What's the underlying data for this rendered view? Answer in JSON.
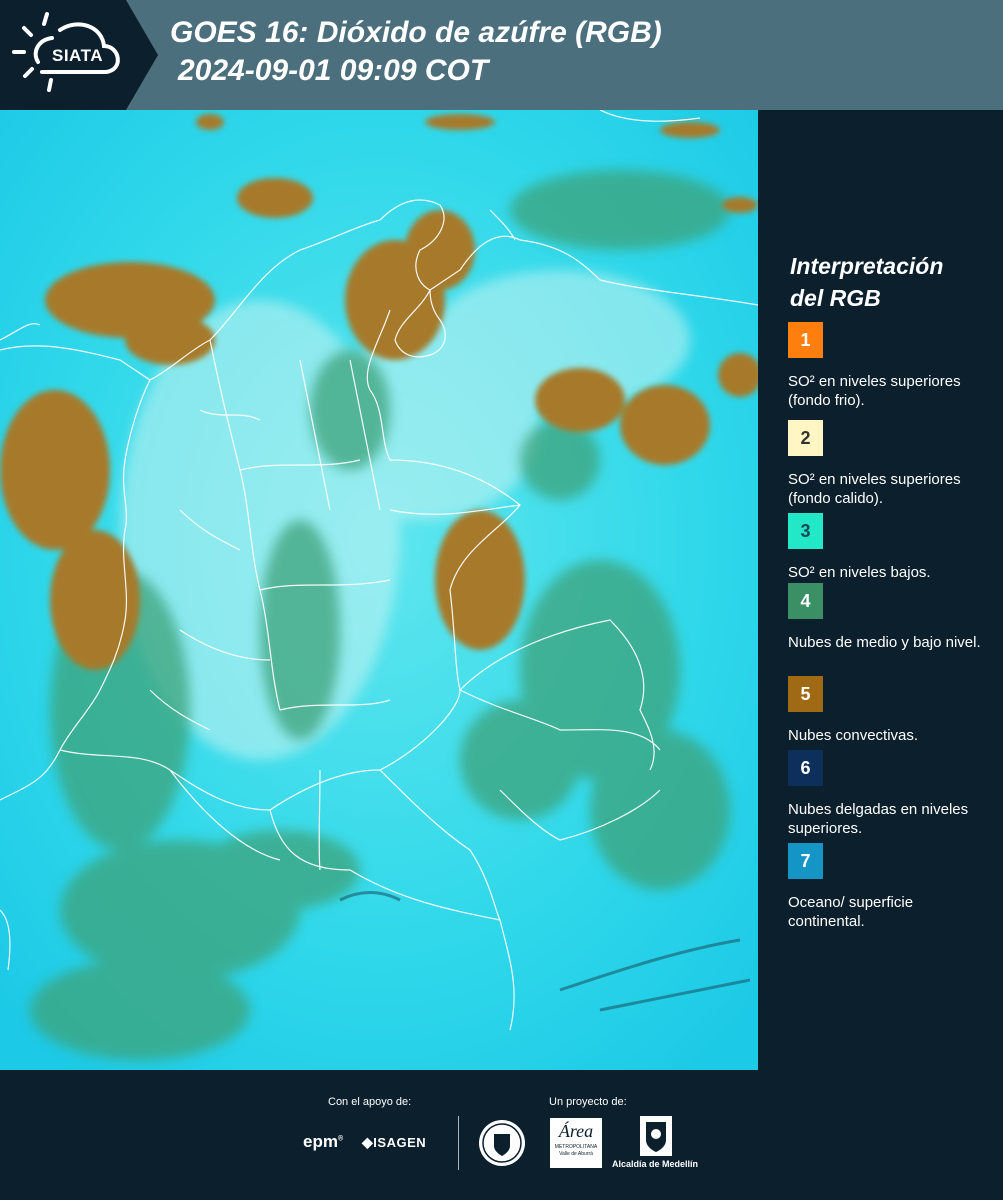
{
  "header": {
    "logo_text": "SIATA",
    "title_line1": "GOES 16: Dióxido de azúfre (RGB)",
    "title_line2": "2024-09-01 09:09 COT"
  },
  "map": {
    "background_color": "#1fd3e6",
    "cloud_color": "#a67a2b",
    "low_cloud_color": "#3ea37a",
    "border_color": "#ffffff"
  },
  "legend": {
    "title_line1": "Interpretación",
    "title_line2": "del RGB",
    "items": [
      {
        "number": "1",
        "color": "#ff7f0e",
        "text_color": "#ffffff",
        "label": "SO² en niveles superiores (fondo frio)."
      },
      {
        "number": "2",
        "color": "#fff6c3",
        "text_color": "#333333",
        "label": "SO² en niveles superiores (fondo calido)."
      },
      {
        "number": "3",
        "color": "#22e8c8",
        "text_color": "#1a4a55",
        "label": "SO² en niveles bajos."
      },
      {
        "number": "4",
        "color": "#3a8f65",
        "text_color": "#ffffff",
        "label": "Nubes de medio y bajo nivel."
      },
      {
        "number": "5",
        "color": "#a06a14",
        "text_color": "#ffffff",
        "label": "Nubes convectivas."
      },
      {
        "number": "6",
        "color": "#0c2f5c",
        "text_color": "#ffffff",
        "label": "Nubes delgadas en niveles superiores."
      },
      {
        "number": "7",
        "color": "#1495c6",
        "text_color": "#ffffff",
        "label": "Oceano/ superficie continental."
      }
    ]
  },
  "footer": {
    "support_label": "Con el apoyo de:",
    "project_label": "Un proyecto de:",
    "partner1": "epm",
    "partner2": "ISAGEN",
    "area_word": "Área",
    "area_sub1": "METROPOLITANA",
    "area_sub2": "Valle de Aburrá",
    "alcaldia": "Alcaldía de Medellín"
  }
}
